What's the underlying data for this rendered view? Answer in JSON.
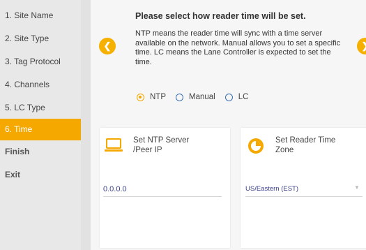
{
  "sidebar": {
    "items": [
      {
        "label": "1. Site Name"
      },
      {
        "label": "2. Site Type"
      },
      {
        "label": "3. Tag Protocol"
      },
      {
        "label": "4. Channels"
      },
      {
        "label": "5. LC Type"
      },
      {
        "label": "6. Time"
      },
      {
        "label": "Finish"
      },
      {
        "label": "Exit"
      }
    ],
    "active_index": 5
  },
  "main": {
    "title": "Please select how reader time will be set.",
    "description": "NTP means the reader time will sync with a time server available on the network. Manual allows you to set a specific time. LC means the Lane Controller is expected to set the time.",
    "radio_options": [
      {
        "label": "NTP",
        "checked": true
      },
      {
        "label": "Manual",
        "checked": false
      },
      {
        "label": "LC",
        "checked": false
      }
    ],
    "ntp_card": {
      "title": "Set NTP Server /Peer IP",
      "value": "0.0.0.0",
      "icon": "laptop-icon"
    },
    "timezone_card": {
      "title": "Set Reader Time Zone",
      "value": "US/Eastern (EST)",
      "icon": "clock-icon"
    }
  },
  "colors": {
    "accent": "#f5a800",
    "radio_unchecked": "#3a6fb0",
    "value_text": "#3a3f8a"
  }
}
